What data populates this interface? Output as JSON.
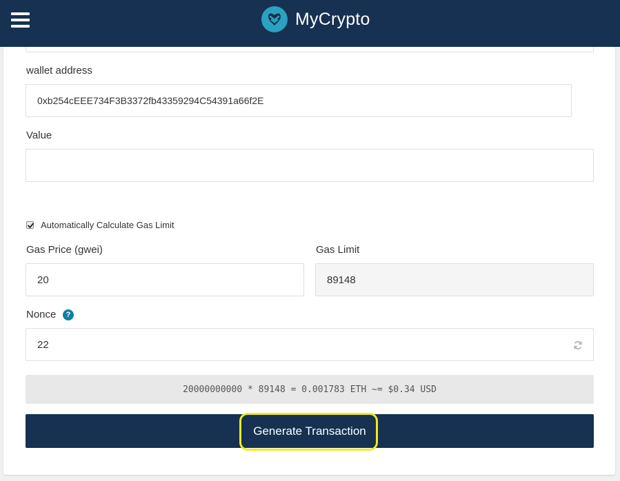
{
  "header": {
    "brand_name": "MyCrypto",
    "menu_icon": "hamburger-menu-icon",
    "logo_icon": "mycrypto-heart-logo-icon",
    "background_color": "#163151"
  },
  "form": {
    "wallet_address": {
      "label": "wallet address",
      "value": "0xb254cEEE734F3B3372fb43359294C54391a66f2E"
    },
    "value_field": {
      "label": "Value",
      "value": ""
    },
    "auto_gas": {
      "label": "Automatically Calculate Gas Limit",
      "checked": true
    },
    "gas_price": {
      "label": "Gas Price (gwei)",
      "value": "20"
    },
    "gas_limit": {
      "label": "Gas Limit",
      "value": "89148"
    },
    "nonce": {
      "label": "Nonce",
      "value": "22",
      "help_icon": "question-circle-icon",
      "refresh_icon": "refresh-icon"
    },
    "fee_summary": "20000000000 * 89148 = 0.001783 ETH ~= $0.34 USD",
    "generate_button": "Generate Transaction",
    "highlight_color": "#f2ea1d"
  }
}
